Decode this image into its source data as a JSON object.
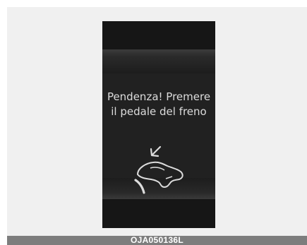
{
  "display": {
    "message_line1": "Pendenza! Premere",
    "message_line2": "il pedale del freno",
    "icon": "foot-on-brake-pedal-icon"
  },
  "footer": {
    "image_code": "OJA050136L"
  },
  "colors": {
    "screen_background": "#161616",
    "text": "#dcdcdc",
    "footer_bar": "#7d7d7d"
  }
}
